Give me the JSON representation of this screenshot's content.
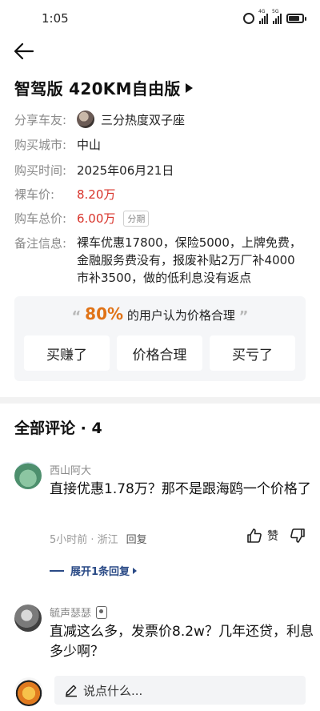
{
  "status_bar": {
    "time": "1:05",
    "network_1": "4G",
    "network_2": "5G",
    "battery_level": 0.8
  },
  "header": {
    "title": "智驾版 420KM自由版"
  },
  "info": {
    "share_label": "分享车友:",
    "share_user": "三分热度双子座",
    "city_label": "购买城市:",
    "city": "中山",
    "date_label": "购买时间:",
    "date": "2025年06月21日",
    "bare_price_label": "裸车价:",
    "bare_price": "8.20万",
    "total_price_label": "购车总价:",
    "total_price": "6.00万",
    "installment_tag": "分期",
    "note_label": "备注信息:",
    "note": "裸车优惠17800，保险5000，上牌免费，金融服务费没有，报废补贴2万厂补4000市补3500，做的低利息没有返点"
  },
  "rating": {
    "quote_open": "“",
    "percent": "80%",
    "text": "的用户认为价格合理",
    "quote_close": "”",
    "buttons": [
      "买赚了",
      "价格合理",
      "买亏了"
    ]
  },
  "comments": {
    "heading": "全部评论 · 4",
    "items": [
      {
        "name": "西山阿大",
        "text": "直接优惠1.78万？那不是跟海鸥一个价格了",
        "time_location": "5小时前 · 浙江",
        "reply": "回复",
        "like": "赞",
        "expand": "展开1条回复"
      },
      {
        "name": "毓声瑟瑟",
        "text": "直减这么多，发票价8.2w？几年还贷，利息多少啊？"
      }
    ]
  },
  "input": {
    "placeholder": "说点什么..."
  }
}
